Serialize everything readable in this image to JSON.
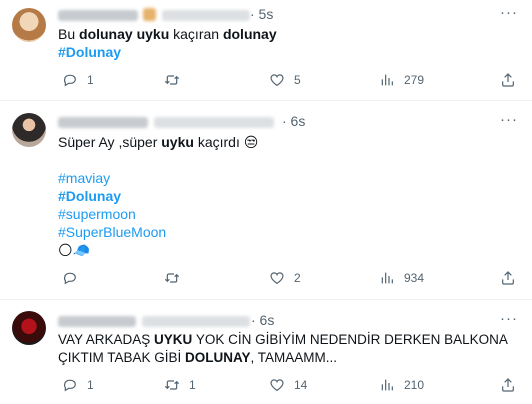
{
  "tweets": [
    {
      "time": "· 5s",
      "text_parts": [
        "Bu ",
        "dolunay uyku",
        " kaçıran ",
        "dolunay"
      ],
      "hashtags": [
        "#Dolunay"
      ],
      "replies": "1",
      "retweets": "",
      "likes": "5",
      "views": "279"
    },
    {
      "time": "· 6s",
      "text_parts": [
        "Süper Ay ,süper ",
        "uyku",
        " kaçırdı 😒"
      ],
      "hashtags": [
        "#maviay",
        "#Dolunay",
        "#supermoon",
        "#SuperBlueMoon"
      ],
      "emoji": "🌕🧢",
      "replies": "",
      "retweets": "",
      "likes": "2",
      "views": "934"
    },
    {
      "time": "· 6s",
      "text_line1_parts": [
        "VAY ARKADAŞ ",
        "UYKU",
        " YOK CİN GİBİYİM NEDENDİR DERKEN BALKONA"
      ],
      "text_line2_parts": [
        "ÇIKTIM TABAK GİBİ ",
        "DOLUNAY",
        ", TAMAAMM..."
      ],
      "replies": "1",
      "retweets": "1",
      "likes": "14",
      "views": "210"
    }
  ],
  "icons": {
    "reply": "reply-icon",
    "retweet": "retweet-icon",
    "like": "heart-icon",
    "views": "views-icon",
    "share": "share-icon",
    "more": "more-icon"
  },
  "colors": {
    "link": "#1d9bf0",
    "muted": "#536471"
  }
}
